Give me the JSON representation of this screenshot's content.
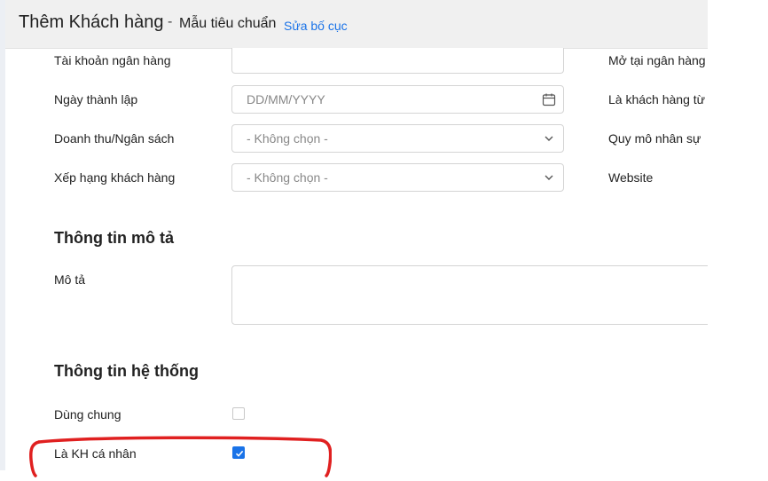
{
  "header": {
    "title": "Thêm Khách hàng",
    "separator": "-",
    "template": "Mẫu tiêu chuẩn",
    "edit_layout": "Sửa bố cục"
  },
  "fields": {
    "bank_account": {
      "label": "Tài khoản ngân hàng",
      "value": ""
    },
    "founded_date": {
      "label": "Ngày thành lập",
      "placeholder": "DD/MM/YYYY"
    },
    "revenue_budget": {
      "label": "Doanh thu/Ngân sách",
      "value": "- Không chọn -"
    },
    "customer_rank": {
      "label": "Xếp hạng khách hàng",
      "value": "- Không chọn -"
    }
  },
  "right_labels": {
    "bank_open_at": "Mở tại ngân hàng",
    "customer_since": "Là khách hàng từ",
    "staff_size": "Quy mô nhân sự",
    "website": "Website"
  },
  "description_section": {
    "title": "Thông tin mô tả",
    "description_label": "Mô tả",
    "description_value": ""
  },
  "system_section": {
    "title": "Thông tin hệ thống",
    "shared": {
      "label": "Dùng chung",
      "checked": false
    },
    "individual": {
      "label": "Là KH cá nhân",
      "checked": true
    }
  },
  "colors": {
    "accent": "#1a73e8",
    "highlight_ring": "#e02020"
  },
  "icons": {
    "calendar": "calendar-icon",
    "chevron": "chevron-down-icon",
    "check": "check-icon"
  }
}
